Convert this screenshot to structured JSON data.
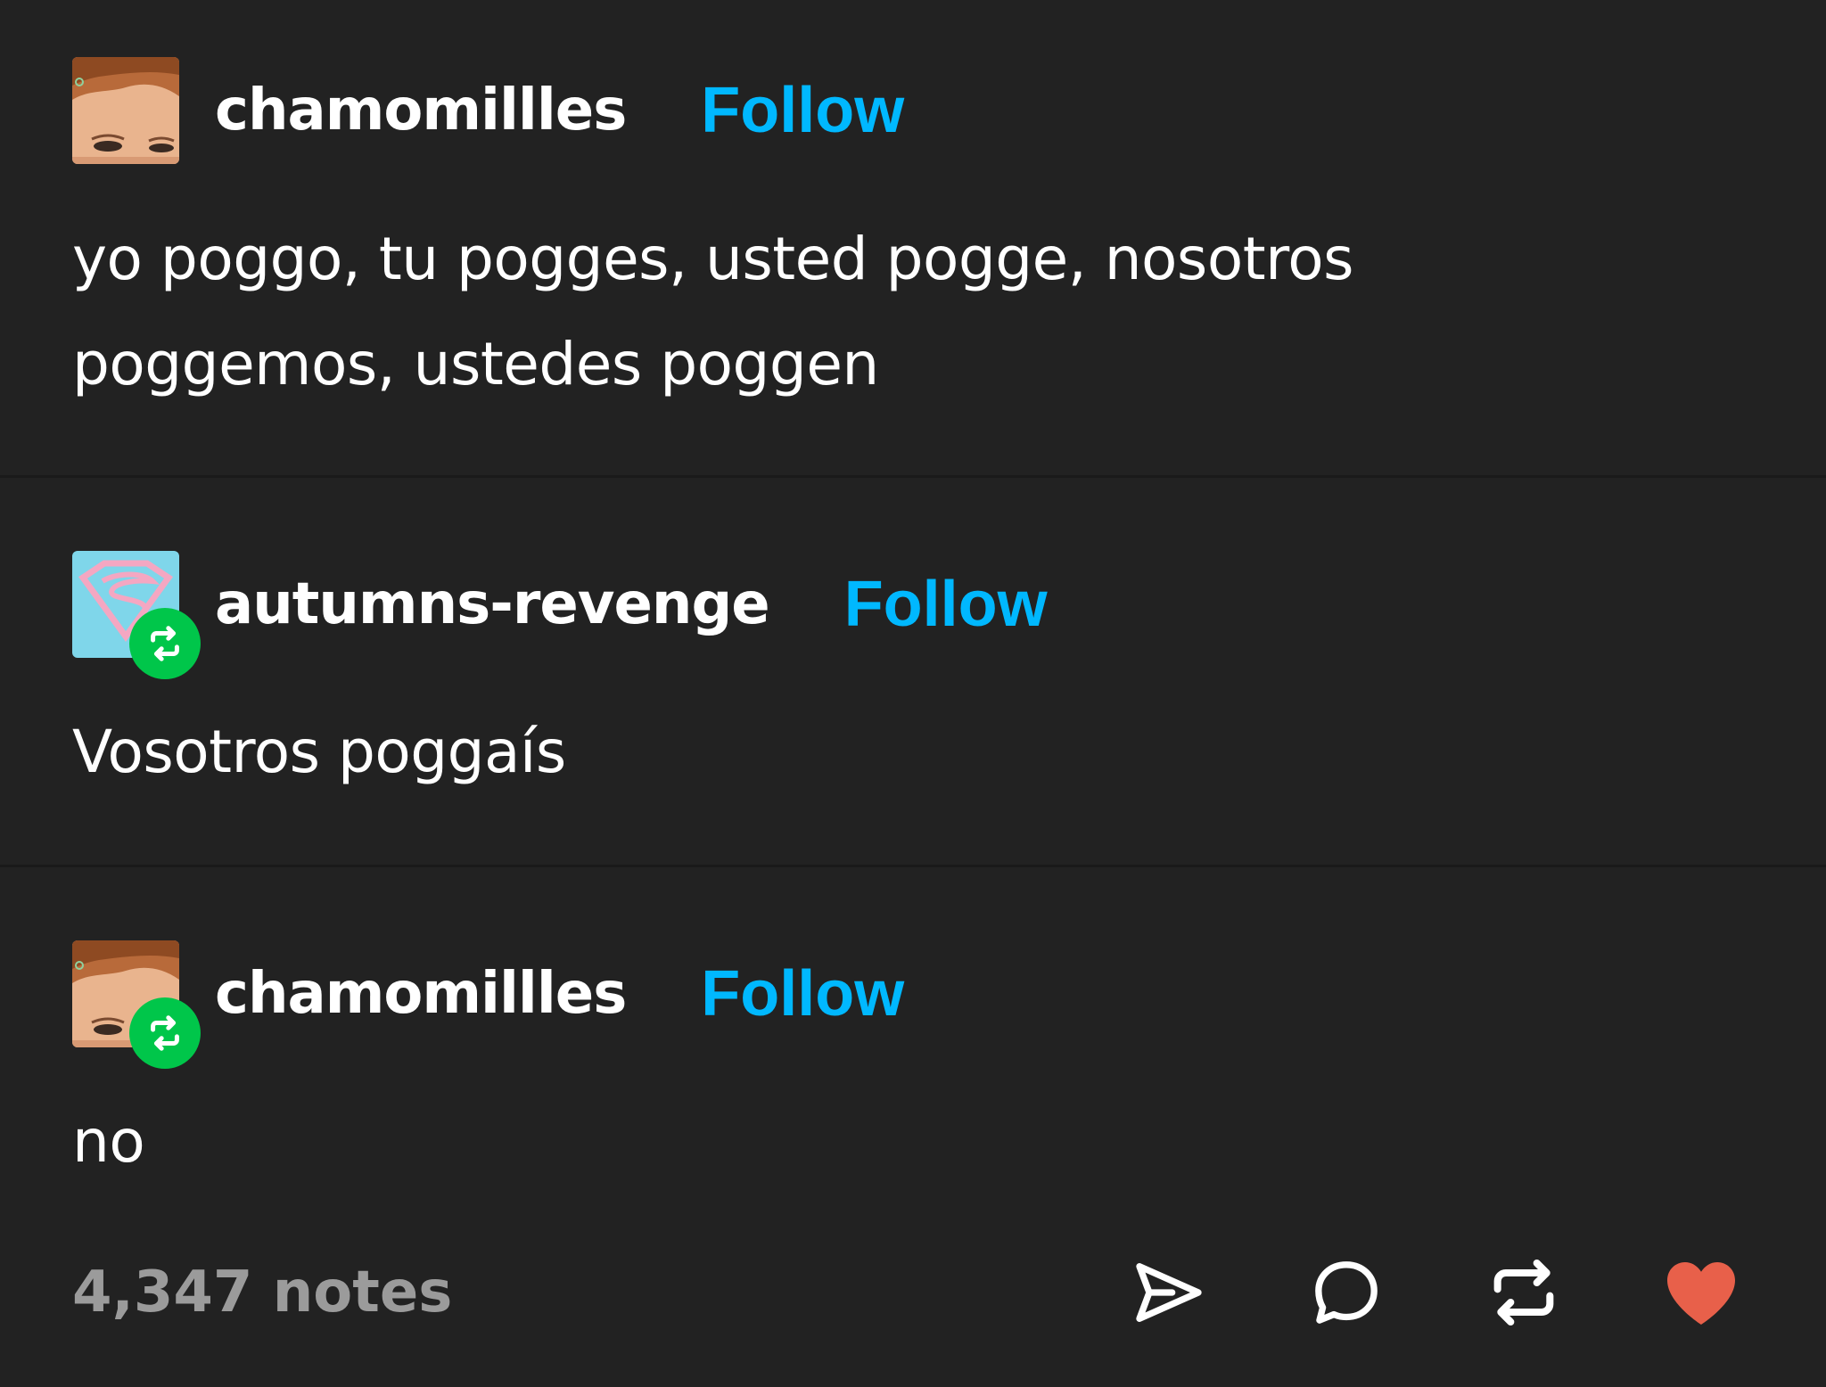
{
  "posts": [
    {
      "username": "chamomillles",
      "follow_label": "Follow",
      "text": "yo poggo, tu pogges, usted pogge, nosotros\npoggemos, ustedes poggen",
      "avatar_icon": "face-photo-avatar",
      "reblog": false
    },
    {
      "username": "autumns-revenge",
      "follow_label": "Follow",
      "text": "Vosotros poggaís",
      "avatar_icon": "superman-logo-avatar",
      "reblog": true
    },
    {
      "username": "chamomillles",
      "follow_label": "Follow",
      "text": "no",
      "avatar_icon": "face-photo-avatar",
      "reblog": true
    }
  ],
  "footer": {
    "notes": "4,347 notes",
    "actions": [
      "share-icon",
      "reply-icon",
      "reblog-icon",
      "like-icon"
    ]
  },
  "colors": {
    "background": "#222222",
    "follow": "#00b8ff",
    "reblog_badge": "#00c64a",
    "like": "#e8604a",
    "notes": "#9b9b9b"
  }
}
